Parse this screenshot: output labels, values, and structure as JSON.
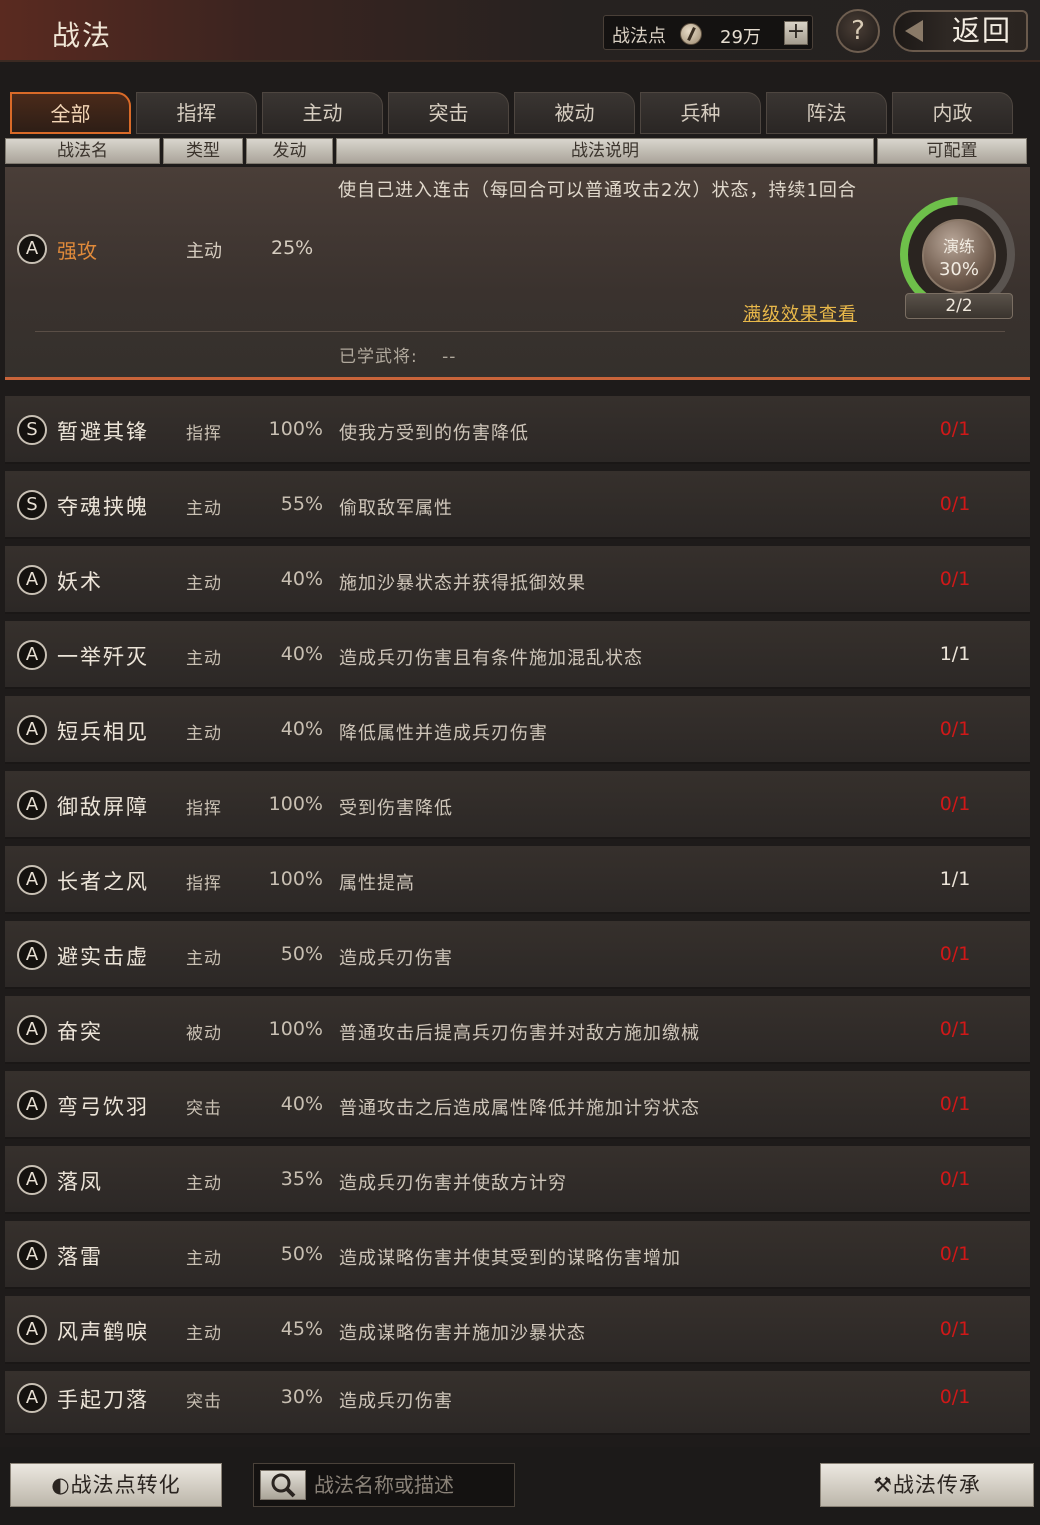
{
  "header": {
    "title": "战法",
    "points_label": "战法点",
    "points_value": "29万",
    "plus_label": "+",
    "help_label": "?",
    "back_label": "返回"
  },
  "tabs": [
    {
      "label": "全部",
      "active": true
    },
    {
      "label": "指挥"
    },
    {
      "label": "主动"
    },
    {
      "label": "突击"
    },
    {
      "label": "被动"
    },
    {
      "label": "兵种"
    },
    {
      "label": "阵法"
    },
    {
      "label": "内政"
    }
  ],
  "columns": {
    "name": "战法名",
    "type": "类型",
    "rate": "发动",
    "desc": "战法说明",
    "count": "可配置"
  },
  "expanded": {
    "grade": "A",
    "name": "强攻",
    "type": "主动",
    "rate": "25%",
    "desc": "使自己进入连击（每回合可以普通攻击2次）状态，持续1回合",
    "practice_label": "演练",
    "practice_value": "30%",
    "level": "2/2",
    "full_effect_link": "满级效果查看",
    "learned_label": "已学武将:",
    "learned_value": "--"
  },
  "rows": [
    {
      "grade": "S",
      "name": "暂避其锋",
      "type": "指挥",
      "rate": "100%",
      "desc": "使我方受到的伤害降低",
      "count": "0/1"
    },
    {
      "grade": "S",
      "name": "夺魂挟魄",
      "type": "主动",
      "rate": "55%",
      "desc": "偷取敌军属性",
      "count": "0/1"
    },
    {
      "grade": "A",
      "name": "妖术",
      "type": "主动",
      "rate": "40%",
      "desc": "施加沙暴状态并获得抵御效果",
      "count": "0/1"
    },
    {
      "grade": "A",
      "name": "一举歼灭",
      "type": "主动",
      "rate": "40%",
      "desc": "造成兵刃伤害且有条件施加混乱状态",
      "count": "1/1"
    },
    {
      "grade": "A",
      "name": "短兵相见",
      "type": "主动",
      "rate": "40%",
      "desc": "降低属性并造成兵刃伤害",
      "count": "0/1"
    },
    {
      "grade": "A",
      "name": "御敌屏障",
      "type": "指挥",
      "rate": "100%",
      "desc": "受到伤害降低",
      "count": "0/1"
    },
    {
      "grade": "A",
      "name": "长者之风",
      "type": "指挥",
      "rate": "100%",
      "desc": "属性提高",
      "count": "1/1"
    },
    {
      "grade": "A",
      "name": "避实击虚",
      "type": "主动",
      "rate": "50%",
      "desc": "造成兵刃伤害",
      "count": "0/1"
    },
    {
      "grade": "A",
      "name": "奋突",
      "type": "被动",
      "rate": "100%",
      "desc": "普通攻击后提高兵刃伤害并对敌方施加缴械",
      "count": "0/1"
    },
    {
      "grade": "A",
      "name": "弯弓饮羽",
      "type": "突击",
      "rate": "40%",
      "desc": "普通攻击之后造成属性降低并施加计穷状态",
      "count": "0/1"
    },
    {
      "grade": "A",
      "name": "落凤",
      "type": "主动",
      "rate": "35%",
      "desc": "造成兵刃伤害并使敌方计穷",
      "count": "0/1"
    },
    {
      "grade": "A",
      "name": "落雷",
      "type": "主动",
      "rate": "50%",
      "desc": "造成谋略伤害并使其受到的谋略伤害增加",
      "count": "0/1"
    },
    {
      "grade": "A",
      "name": "风声鹤唳",
      "type": "主动",
      "rate": "45%",
      "desc": "造成谋略伤害并施加沙暴状态",
      "count": "0/1"
    },
    {
      "grade": "A",
      "name": "手起刀落",
      "type": "突击",
      "rate": "30%",
      "desc": "造成兵刃伤害",
      "count": "0/1"
    }
  ],
  "footer": {
    "convert_label": "战法点转化",
    "search_placeholder": "战法名称或描述",
    "inherit_label": "战法传承"
  },
  "colors": {
    "accent_orange": "#d96a28",
    "count_red": "#d01818",
    "link_gold": "#e8b84a",
    "practice_green": "#6ec04a"
  }
}
